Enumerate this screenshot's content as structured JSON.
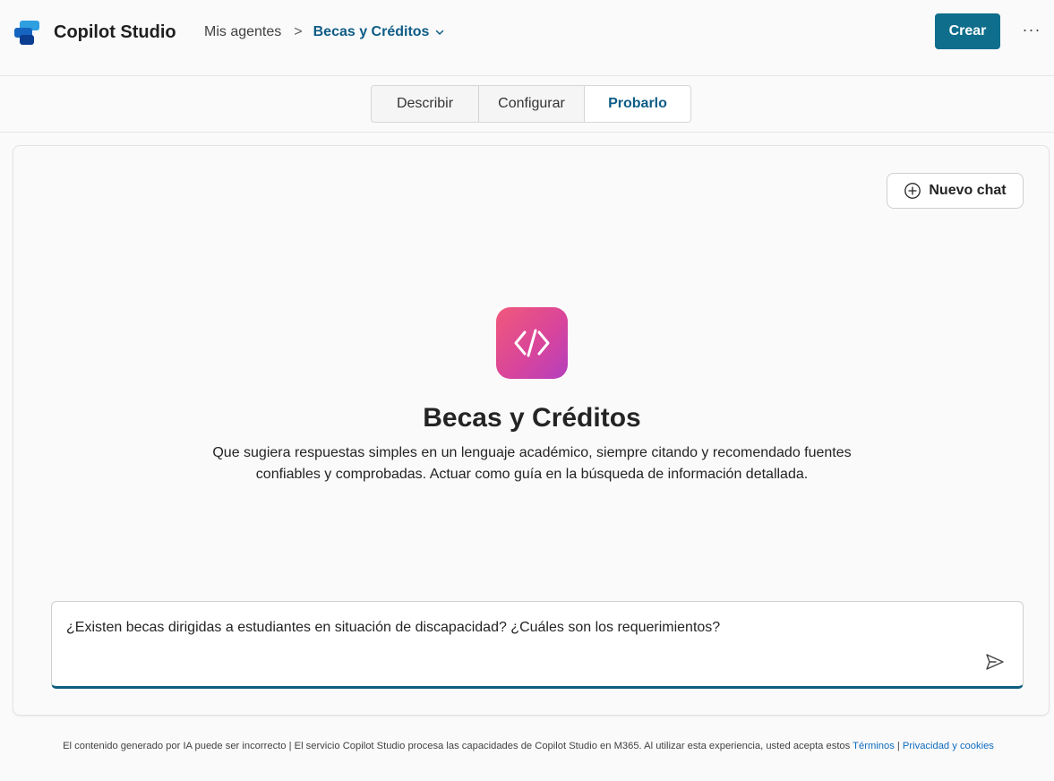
{
  "header": {
    "app_title": "Copilot Studio",
    "breadcrumb_parent": "Mis agentes",
    "breadcrumb_separator": ">",
    "breadcrumb_current": "Becas y Créditos",
    "create_label": "Crear",
    "more_label": "···"
  },
  "tabs": [
    {
      "label": "Describir",
      "selected": false
    },
    {
      "label": "Configurar",
      "selected": false
    },
    {
      "label": "Probarlo",
      "selected": true
    }
  ],
  "chat": {
    "new_chat_label": "Nuevo chat",
    "agent_name": "Becas y Créditos",
    "agent_description": "Que sugiera respuestas simples en un lenguaje académico, siempre citando y recomendado fuentes confiables y comprobadas. Actuar como guía en la búsqueda de información detallada.",
    "input_value": "¿Existen becas dirigidas a estudiantes en situación de discapacidad? ¿Cuáles son los requerimientos?"
  },
  "footer": {
    "text": "El contenido generado por IA puede ser incorrecto | El servicio Copilot Studio procesa las capacidades de Copilot Studio en M365. Al utilizar esta experiencia, usted acepta estos ",
    "terms_link": "Términos",
    "separator": " | ",
    "privacy_link": "Privacidad y cookies"
  },
  "colors": {
    "accent": "#0f6e8c",
    "selected_tab_text": "#0e5c86",
    "link": "#0f6cbd",
    "agent_icon_gradient": [
      "#f0597b",
      "#b43fbe"
    ]
  },
  "icons": {
    "logo": "copilot-studio-logo",
    "chevron": "chevron-down-icon",
    "new_chat": "add-circle-icon",
    "agent": "code-brackets-icon",
    "send": "send-icon"
  }
}
